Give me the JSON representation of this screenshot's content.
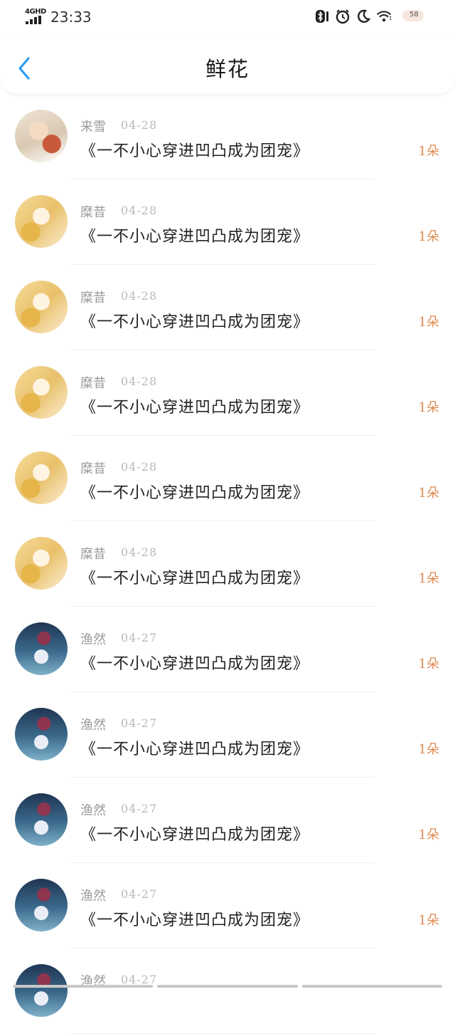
{
  "status_bar": {
    "network": "4GHD",
    "time": "23:33",
    "battery": "58"
  },
  "header": {
    "title": "鲜花"
  },
  "rows": [
    {
      "user": "来雪",
      "date": "04-28",
      "book": "《一不小心穿进凹凸成为团宠》",
      "count": "1朵",
      "avatar": "av-snow"
    },
    {
      "user": "糜昔",
      "date": "04-28",
      "book": "《一不小心穿进凹凸成为团宠》",
      "count": "1朵",
      "avatar": "av-kang"
    },
    {
      "user": "糜昔",
      "date": "04-28",
      "book": "《一不小心穿进凹凸成为团宠》",
      "count": "1朵",
      "avatar": "av-kang"
    },
    {
      "user": "糜昔",
      "date": "04-28",
      "book": "《一不小心穿进凹凸成为团宠》",
      "count": "1朵",
      "avatar": "av-kang"
    },
    {
      "user": "糜昔",
      "date": "04-28",
      "book": "《一不小心穿进凹凸成为团宠》",
      "count": "1朵",
      "avatar": "av-kang"
    },
    {
      "user": "糜昔",
      "date": "04-28",
      "book": "《一不小心穿进凹凸成为团宠》",
      "count": "1朵",
      "avatar": "av-kang"
    },
    {
      "user": "渔然",
      "date": "04-27",
      "book": "《一不小心穿进凹凸成为团宠》",
      "count": "1朵",
      "avatar": "av-yu"
    },
    {
      "user": "渔然",
      "date": "04-27",
      "book": "《一不小心穿进凹凸成为团宠》",
      "count": "1朵",
      "avatar": "av-yu"
    },
    {
      "user": "渔然",
      "date": "04-27",
      "book": "《一不小心穿进凹凸成为团宠》",
      "count": "1朵",
      "avatar": "av-yu"
    },
    {
      "user": "渔然",
      "date": "04-27",
      "book": "《一不小心穿进凹凸成为团宠》",
      "count": "1朵",
      "avatar": "av-yu"
    },
    {
      "user": "渔然",
      "date": "04-27",
      "book": "",
      "count": "",
      "avatar": "av-yu"
    }
  ],
  "colors": {
    "accent": "#2a9df4",
    "flower_count": "#e08a50"
  }
}
